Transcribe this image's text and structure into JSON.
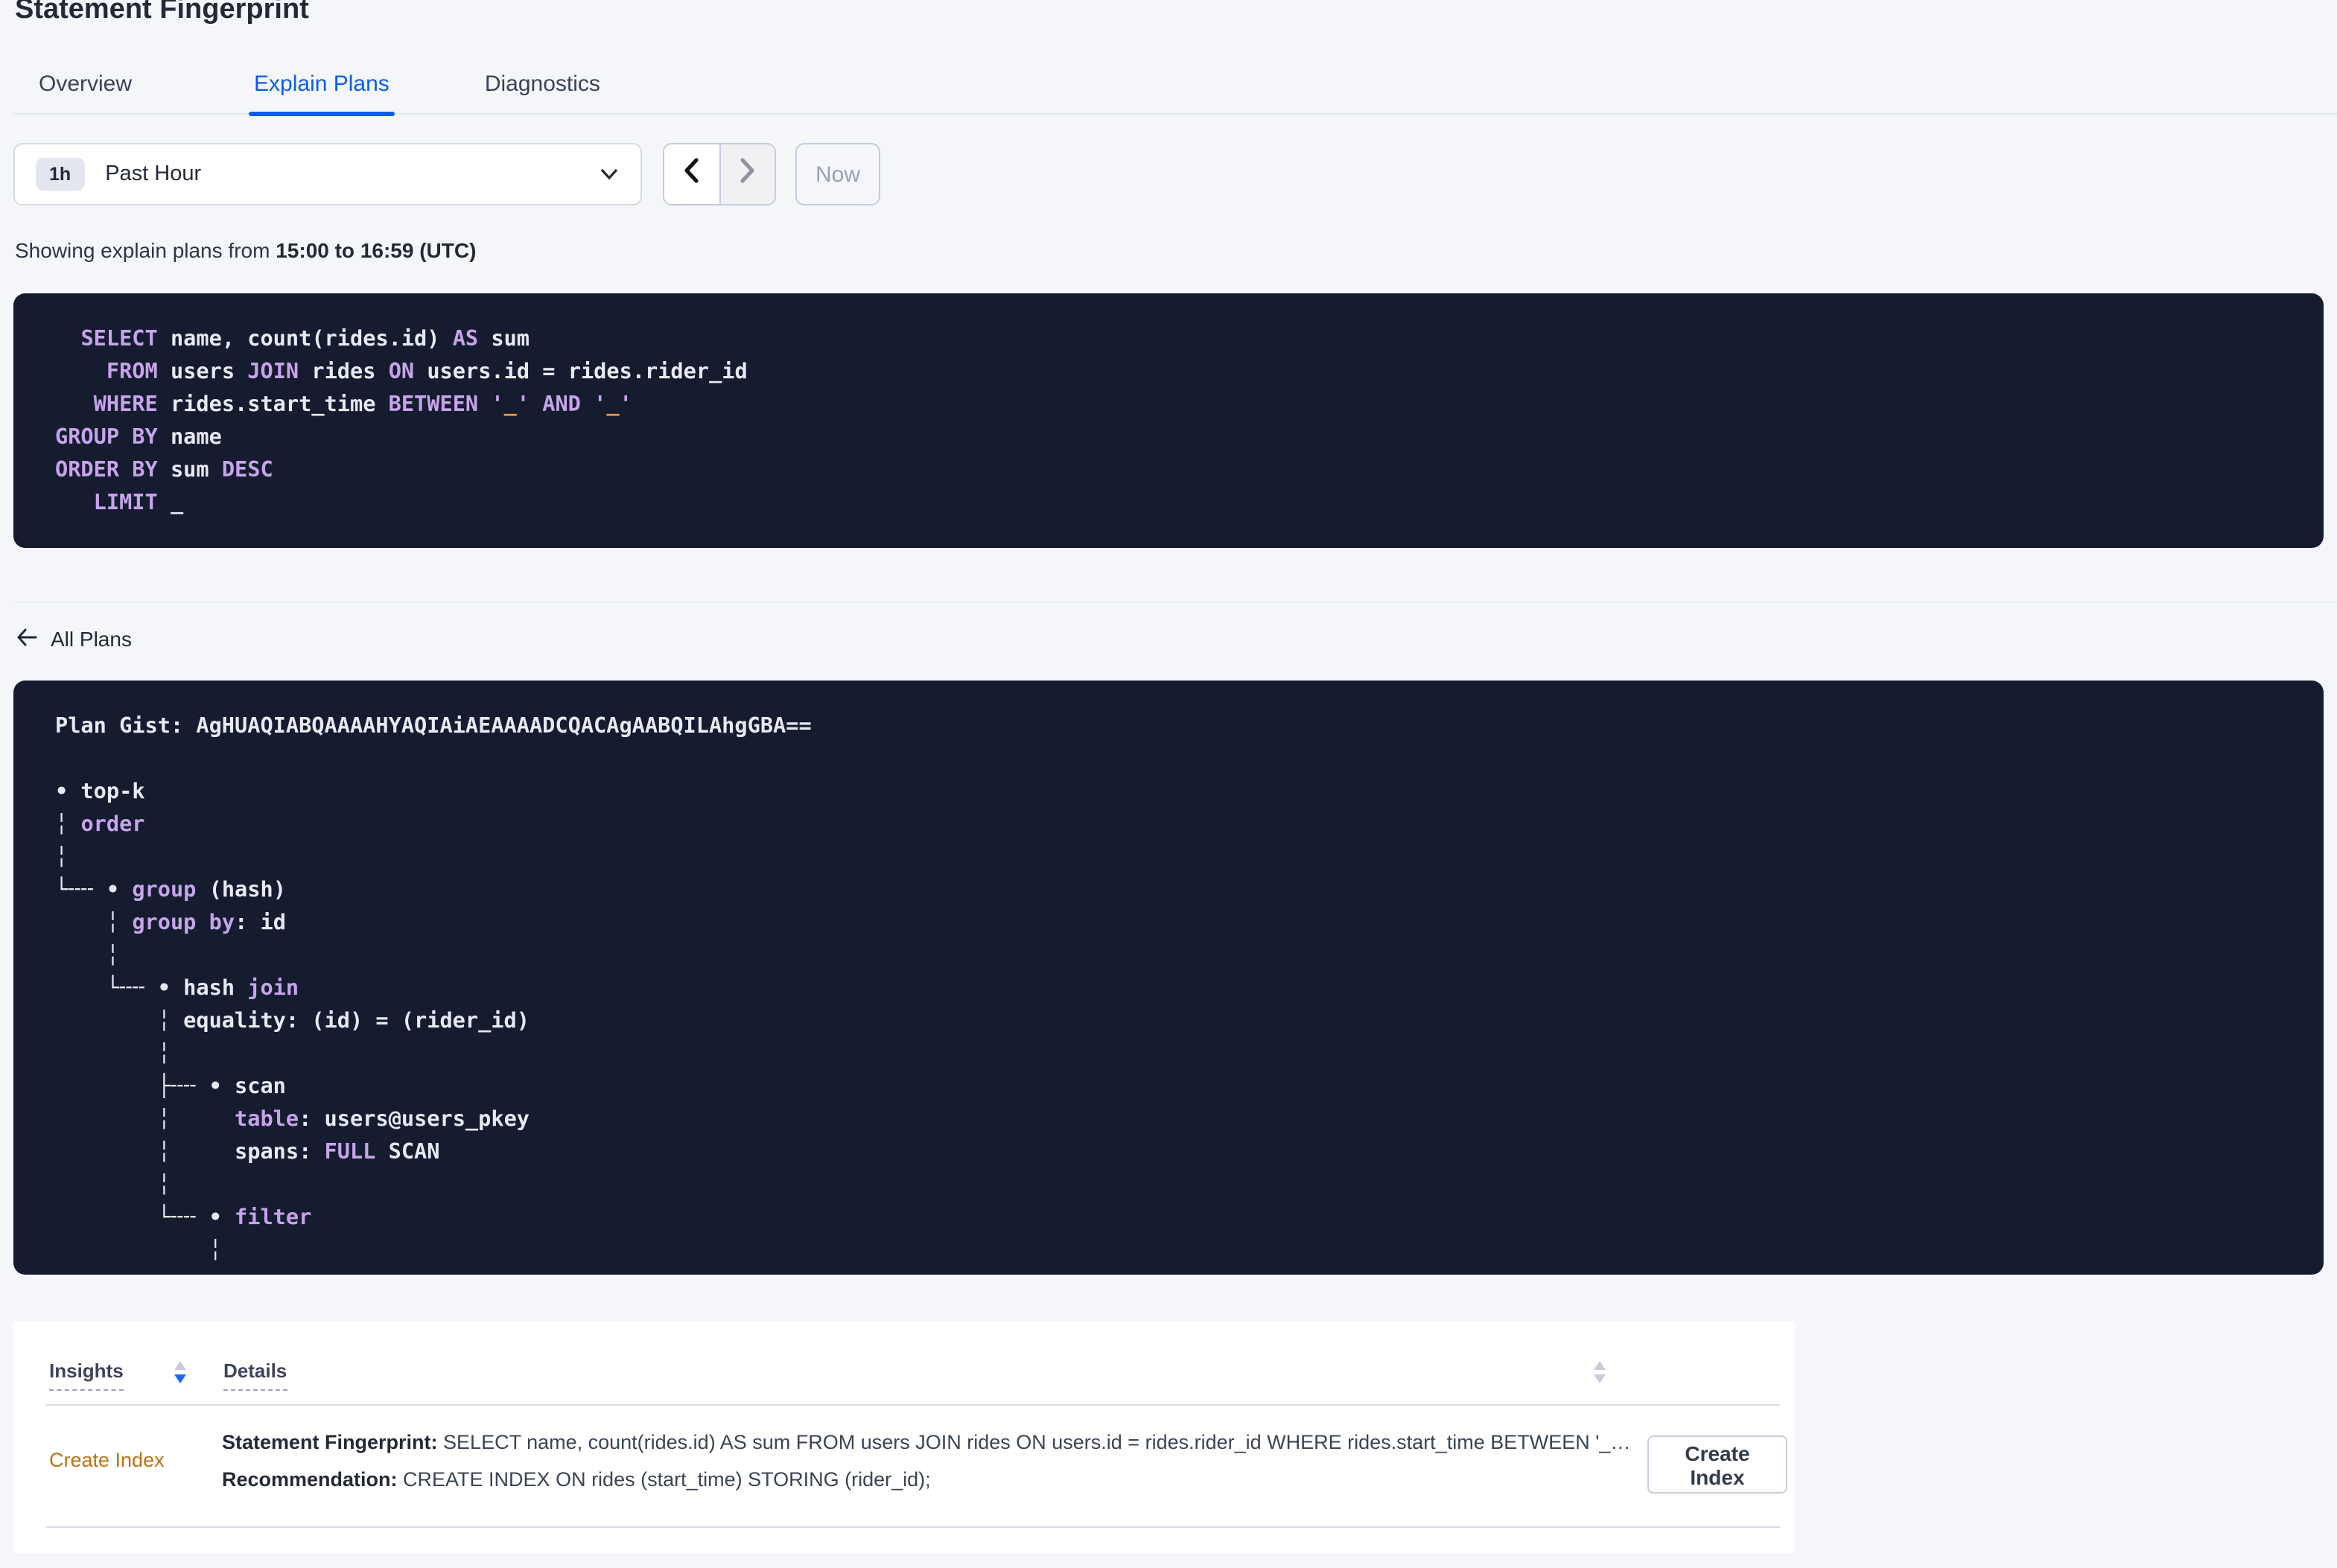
{
  "page": {
    "title": "Statement Fingerprint"
  },
  "tabs": [
    {
      "label": "Overview",
      "active": false
    },
    {
      "label": "Explain Plans",
      "active": true
    },
    {
      "label": "Diagnostics",
      "active": false
    }
  ],
  "time_picker": {
    "badge": "1h",
    "selected_label": "Past Hour",
    "now_label": "Now"
  },
  "showing": {
    "prefix": "Showing explain plans from ",
    "range_bold": "15:00 to 16:59 (UTC)"
  },
  "sql": {
    "lines": [
      [
        [
          "id",
          "  "
        ],
        [
          "kw",
          "SELECT"
        ],
        [
          "id",
          " name, count(rides.id) "
        ],
        [
          "kw",
          "AS"
        ],
        [
          "id",
          " sum"
        ]
      ],
      [
        [
          "id",
          "    "
        ],
        [
          "kw",
          "FROM"
        ],
        [
          "id",
          " users "
        ],
        [
          "kw",
          "JOIN"
        ],
        [
          "id",
          " rides "
        ],
        [
          "kw",
          "ON"
        ],
        [
          "id",
          " users.id = rides.rider_id"
        ]
      ],
      [
        [
          "id",
          "   "
        ],
        [
          "kw",
          "WHERE"
        ],
        [
          "id",
          " rides.start_time "
        ],
        [
          "kw",
          "BETWEEN"
        ],
        [
          "id",
          " "
        ],
        [
          "kw",
          "'"
        ],
        [
          "lit",
          "_"
        ],
        [
          "kw",
          "'"
        ],
        [
          "id",
          " "
        ],
        [
          "kw",
          "AND"
        ],
        [
          "id",
          " "
        ],
        [
          "kw",
          "'"
        ],
        [
          "lit",
          "_"
        ],
        [
          "kw",
          "'"
        ]
      ],
      [
        [
          "kw",
          "GROUP BY"
        ],
        [
          "id",
          " name"
        ]
      ],
      [
        [
          "kw",
          "ORDER BY"
        ],
        [
          "id",
          " sum "
        ],
        [
          "kw",
          "DESC"
        ]
      ],
      [
        [
          "id",
          "   "
        ],
        [
          "kw",
          "LIMIT"
        ],
        [
          "id",
          " _"
        ]
      ]
    ]
  },
  "all_plans_label": "All Plans",
  "plan": {
    "gist_label": "Plan Gist: ",
    "gist": "AgHUAQIABQAAAAHYAQIAiAEAAAADCQACAgAABQILAhgGBA==",
    "tree_lines": [
      [
        [
          "w",
          "• top-k"
        ]
      ],
      [
        [
          "c",
          "╎ "
        ],
        [
          "kw",
          "order"
        ]
      ],
      [
        [
          "c",
          "╎"
        ]
      ],
      [
        [
          "c",
          "└╌╌ "
        ],
        [
          "w",
          "• "
        ],
        [
          "kw",
          "group"
        ],
        [
          "w",
          " (hash)"
        ]
      ],
      [
        [
          "c",
          "    ╎ "
        ],
        [
          "kw",
          "group by"
        ],
        [
          "w",
          ": id"
        ]
      ],
      [
        [
          "c",
          "    ╎"
        ]
      ],
      [
        [
          "c",
          "    └╌╌ "
        ],
        [
          "w",
          "• hash "
        ],
        [
          "kw",
          "join"
        ]
      ],
      [
        [
          "c",
          "        ╎ "
        ],
        [
          "w",
          "equality: (id) = (rider_id)"
        ]
      ],
      [
        [
          "c",
          "        ╎"
        ]
      ],
      [
        [
          "c",
          "        ├╌╌ "
        ],
        [
          "w",
          "• scan"
        ]
      ],
      [
        [
          "c",
          "        ╎"
        ],
        [
          "w",
          "     "
        ],
        [
          "kw",
          "table"
        ],
        [
          "w",
          ": users@users_pkey"
        ]
      ],
      [
        [
          "c",
          "        ╎"
        ],
        [
          "w",
          "     spans: "
        ],
        [
          "kw",
          "FULL"
        ],
        [
          "w",
          " SCAN"
        ]
      ],
      [
        [
          "c",
          "        ╎"
        ]
      ],
      [
        [
          "c",
          "        └╌╌ "
        ],
        [
          "w",
          "• "
        ],
        [
          "kw",
          "filter"
        ]
      ],
      [
        [
          "c",
          "            ╎"
        ]
      ]
    ]
  },
  "insights_table": {
    "columns": [
      {
        "label": "Insights",
        "sort": "desc"
      },
      {
        "label": "Details",
        "sort": "none"
      }
    ],
    "rows": [
      {
        "insight_label": "Create Index",
        "fingerprint_label": "Statement Fingerprint:",
        "fingerprint_text": " SELECT name, count(rides.id) AS sum FROM users JOIN rides ON users.id = rides.rider_id WHERE rides.start_time BETWEEN '_…",
        "recommendation_label": "Recommendation:",
        "recommendation_text": " CREATE INDEX ON rides (start_time) STORING (rider_id);",
        "action_label": "Create Index"
      }
    ]
  },
  "colors": {
    "accent_blue": "#0b5cf5",
    "sort_active_blue": "#2166f4",
    "code_background": "#151c30",
    "keyword_purple": "#c7a4ea",
    "literal_orange": "#eda04a",
    "code_text": "#e7eaf2",
    "insight_link_orange": "#bf7214",
    "page_background": "#f5f6fa",
    "title_text": "#242a35"
  }
}
